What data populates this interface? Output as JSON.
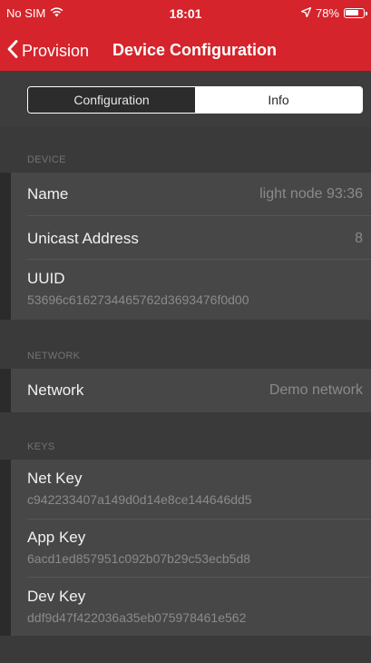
{
  "status_bar": {
    "carrier": "No SIM",
    "time": "18:01",
    "battery": "78%",
    "battery_level": 0.78,
    "icons": [
      "wifi-icon",
      "location-arrow-icon",
      "battery-icon"
    ]
  },
  "nav": {
    "back_label": "Provision",
    "title": "Device Configuration",
    "accent_color": "#d5242b"
  },
  "segments": {
    "items": [
      {
        "label": "Configuration",
        "selected": false
      },
      {
        "label": "Info",
        "selected": true
      }
    ]
  },
  "sections": {
    "device": {
      "header": "DEVICE",
      "name_title": "Name",
      "name_value": "light node 93:36",
      "unicast_title": "Unicast Address",
      "unicast_value": "8",
      "uuid_title": "UUID",
      "uuid_value": "53696c6162734465762d3693476f0d00"
    },
    "network": {
      "header": "NETWORK",
      "network_title": "Network",
      "network_value": "Demo network"
    },
    "keys": {
      "header": "KEYS",
      "net_key_title": "Net Key",
      "net_key_value": "c942233407a149d0d14e8ce144646dd5",
      "app_key_title": "App Key",
      "app_key_value": "6acd1ed857951c092b07b29c53ecb5d8",
      "dev_key_title": "Dev Key",
      "dev_key_value": "ddf9d47f422036a35eb075978461e562"
    }
  }
}
